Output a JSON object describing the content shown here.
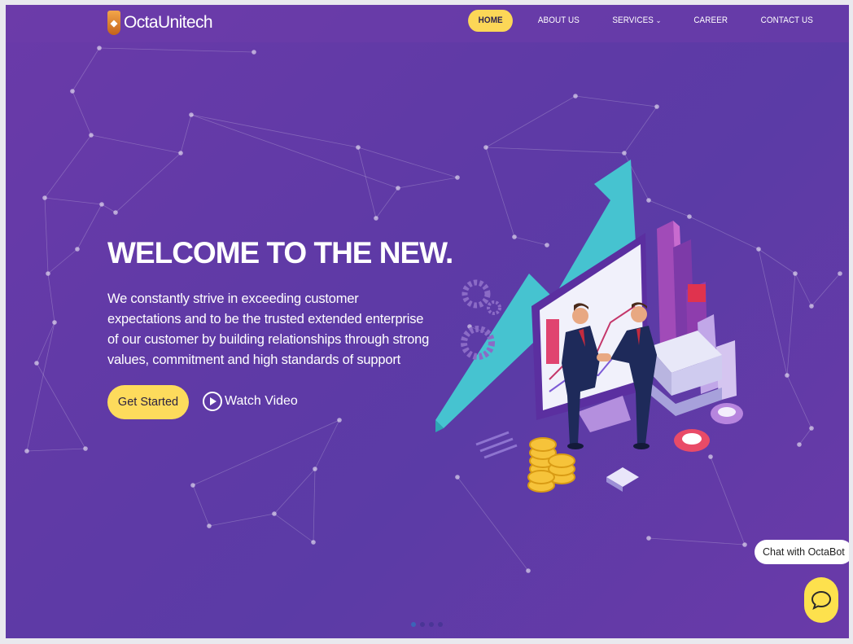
{
  "brand": {
    "name": "OctaUnitech",
    "icon": "shield-logo-icon"
  },
  "nav": {
    "items": [
      {
        "label": "HOME",
        "active": true
      },
      {
        "label": "ABOUT US"
      },
      {
        "label": "SERVICES",
        "has_dropdown": true
      },
      {
        "label": "CAREER"
      },
      {
        "label": "CONTACT US"
      }
    ]
  },
  "hero": {
    "title": "WELCOME TO THE NEW.",
    "text": "We constantly strive in exceeding customer expectations and to be the trusted extended enterprise of our customer by building relationships through strong values, commitment and high standards of support",
    "primary_button": "Get Started",
    "secondary_button": "Watch Video",
    "illustration": "business-handshake-growth-illustration"
  },
  "chat": {
    "label": "Chat with OctaBot",
    "icon": "chat-bubble-icon"
  },
  "slider": {
    "count": 4,
    "active_index": 0
  },
  "colors": {
    "background": "#6139a8",
    "accent": "#fcd757",
    "text": "#ffffff"
  }
}
